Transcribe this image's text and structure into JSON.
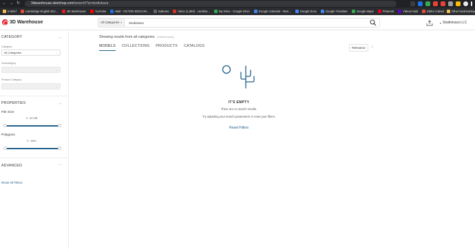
{
  "browser": {
    "url_host": "3dwarehouse.sketchup.com",
    "url_path": "/search/?q=studiokaza",
    "nav_back": "←",
    "nav_forward": "→",
    "nav_reload": "↻",
    "bookmarks": [
      {
        "label": "K-Brief",
        "color": "#f2c14e"
      },
      {
        "label": "Cambridge English Dict...",
        "color": "#e94b3c"
      },
      {
        "label": "3D Warehouse",
        "color": "#e41e26"
      },
      {
        "label": "YouTube",
        "color": "#ff0000"
      },
      {
        "label": "Mail - VICTOR EDUCAR...",
        "color": "#1a73e8"
      },
      {
        "label": "Sabores",
        "color": "#666666"
      },
      {
        "label": "Inbox (1,803) - carolina...",
        "color": "#d93025"
      },
      {
        "label": "My Drive - Google Drive",
        "color": "#34a853"
      },
      {
        "label": "Google Calendar - Mon...",
        "color": "#4285f4"
      },
      {
        "label": "Google Docs",
        "color": "#4285f4"
      },
      {
        "label": "Google Translate",
        "color": "#4285f4"
      },
      {
        "label": "Google Maps",
        "color": "#34a853"
      },
      {
        "label": "Pinterest",
        "color": "#e60023"
      },
      {
        "label": "Yahoo! Mail",
        "color": "#6001d2"
      },
      {
        "label": "Editor Calendário de Co...",
        "color": "#e94b3c"
      },
      {
        "label": "Proyectos 5_Nave Interna...",
        "color": "#d93025"
      }
    ],
    "bookmarks_right": "Other bookmarks"
  },
  "header": {
    "logo_text": "3D Warehouse",
    "category_select": "All Categories",
    "search_value": "Studiokaza",
    "user_name": "Studiokaza LLC"
  },
  "sidebar": {
    "category_title": "CATEGORY",
    "category_label": "Category",
    "category_value": "All Categories",
    "subcategory_label": "Subcategory",
    "product_category_label": "Product Category",
    "properties_title": "PROPERTIES",
    "file_size_label": "File Size",
    "file_size_range": "0 - 50 MB",
    "polygons_label": "Polygons",
    "polygons_range": "0 - MAX",
    "advanced_title": "ADVANCED",
    "reset_label": "Reset All Filters"
  },
  "main": {
    "showing_text": "Showing results from all categories",
    "count_text": "(0 items found)",
    "tabs": [
      {
        "label": "MODELS",
        "active": true
      },
      {
        "label": "COLLECTIONS",
        "active": false
      },
      {
        "label": "PRODUCTS",
        "active": false
      },
      {
        "label": "CATALOGS",
        "active": false
      }
    ],
    "sort_label": "Relevance",
    "sort_arrow": "↓",
    "empty_title": "IT'S EMPTY",
    "empty_sub": "There are no search results.",
    "empty_hint": "Try adjusting your search parameters or reset your filters.",
    "reset_filters": "Reset Filters"
  },
  "colors": {
    "brand_red": "#e41e26",
    "accent_blue": "#1f5f8b",
    "chrome_dark": "#202124"
  }
}
